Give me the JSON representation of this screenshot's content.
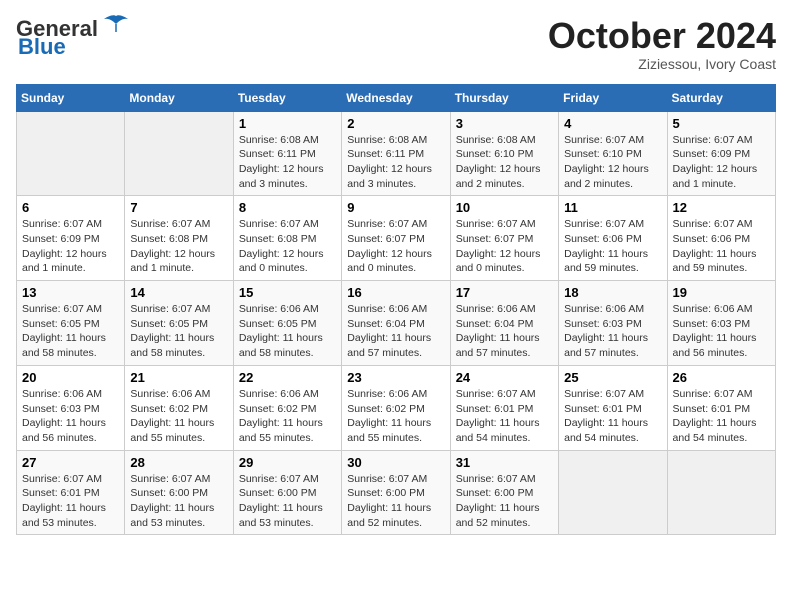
{
  "header": {
    "logo_line1": "General",
    "logo_line2": "Blue",
    "month": "October 2024",
    "location": "Ziziessou, Ivory Coast"
  },
  "weekdays": [
    "Sunday",
    "Monday",
    "Tuesday",
    "Wednesday",
    "Thursday",
    "Friday",
    "Saturday"
  ],
  "weeks": [
    [
      {
        "day": "",
        "info": ""
      },
      {
        "day": "",
        "info": ""
      },
      {
        "day": "1",
        "info": "Sunrise: 6:08 AM\nSunset: 6:11 PM\nDaylight: 12 hours and 3 minutes."
      },
      {
        "day": "2",
        "info": "Sunrise: 6:08 AM\nSunset: 6:11 PM\nDaylight: 12 hours and 3 minutes."
      },
      {
        "day": "3",
        "info": "Sunrise: 6:08 AM\nSunset: 6:10 PM\nDaylight: 12 hours and 2 minutes."
      },
      {
        "day": "4",
        "info": "Sunrise: 6:07 AM\nSunset: 6:10 PM\nDaylight: 12 hours and 2 minutes."
      },
      {
        "day": "5",
        "info": "Sunrise: 6:07 AM\nSunset: 6:09 PM\nDaylight: 12 hours and 1 minute."
      }
    ],
    [
      {
        "day": "6",
        "info": "Sunrise: 6:07 AM\nSunset: 6:09 PM\nDaylight: 12 hours and 1 minute."
      },
      {
        "day": "7",
        "info": "Sunrise: 6:07 AM\nSunset: 6:08 PM\nDaylight: 12 hours and 1 minute."
      },
      {
        "day": "8",
        "info": "Sunrise: 6:07 AM\nSunset: 6:08 PM\nDaylight: 12 hours and 0 minutes."
      },
      {
        "day": "9",
        "info": "Sunrise: 6:07 AM\nSunset: 6:07 PM\nDaylight: 12 hours and 0 minutes."
      },
      {
        "day": "10",
        "info": "Sunrise: 6:07 AM\nSunset: 6:07 PM\nDaylight: 12 hours and 0 minutes."
      },
      {
        "day": "11",
        "info": "Sunrise: 6:07 AM\nSunset: 6:06 PM\nDaylight: 11 hours and 59 minutes."
      },
      {
        "day": "12",
        "info": "Sunrise: 6:07 AM\nSunset: 6:06 PM\nDaylight: 11 hours and 59 minutes."
      }
    ],
    [
      {
        "day": "13",
        "info": "Sunrise: 6:07 AM\nSunset: 6:05 PM\nDaylight: 11 hours and 58 minutes."
      },
      {
        "day": "14",
        "info": "Sunrise: 6:07 AM\nSunset: 6:05 PM\nDaylight: 11 hours and 58 minutes."
      },
      {
        "day": "15",
        "info": "Sunrise: 6:06 AM\nSunset: 6:05 PM\nDaylight: 11 hours and 58 minutes."
      },
      {
        "day": "16",
        "info": "Sunrise: 6:06 AM\nSunset: 6:04 PM\nDaylight: 11 hours and 57 minutes."
      },
      {
        "day": "17",
        "info": "Sunrise: 6:06 AM\nSunset: 6:04 PM\nDaylight: 11 hours and 57 minutes."
      },
      {
        "day": "18",
        "info": "Sunrise: 6:06 AM\nSunset: 6:03 PM\nDaylight: 11 hours and 57 minutes."
      },
      {
        "day": "19",
        "info": "Sunrise: 6:06 AM\nSunset: 6:03 PM\nDaylight: 11 hours and 56 minutes."
      }
    ],
    [
      {
        "day": "20",
        "info": "Sunrise: 6:06 AM\nSunset: 6:03 PM\nDaylight: 11 hours and 56 minutes."
      },
      {
        "day": "21",
        "info": "Sunrise: 6:06 AM\nSunset: 6:02 PM\nDaylight: 11 hours and 55 minutes."
      },
      {
        "day": "22",
        "info": "Sunrise: 6:06 AM\nSunset: 6:02 PM\nDaylight: 11 hours and 55 minutes."
      },
      {
        "day": "23",
        "info": "Sunrise: 6:06 AM\nSunset: 6:02 PM\nDaylight: 11 hours and 55 minutes."
      },
      {
        "day": "24",
        "info": "Sunrise: 6:07 AM\nSunset: 6:01 PM\nDaylight: 11 hours and 54 minutes."
      },
      {
        "day": "25",
        "info": "Sunrise: 6:07 AM\nSunset: 6:01 PM\nDaylight: 11 hours and 54 minutes."
      },
      {
        "day": "26",
        "info": "Sunrise: 6:07 AM\nSunset: 6:01 PM\nDaylight: 11 hours and 54 minutes."
      }
    ],
    [
      {
        "day": "27",
        "info": "Sunrise: 6:07 AM\nSunset: 6:01 PM\nDaylight: 11 hours and 53 minutes."
      },
      {
        "day": "28",
        "info": "Sunrise: 6:07 AM\nSunset: 6:00 PM\nDaylight: 11 hours and 53 minutes."
      },
      {
        "day": "29",
        "info": "Sunrise: 6:07 AM\nSunset: 6:00 PM\nDaylight: 11 hours and 53 minutes."
      },
      {
        "day": "30",
        "info": "Sunrise: 6:07 AM\nSunset: 6:00 PM\nDaylight: 11 hours and 52 minutes."
      },
      {
        "day": "31",
        "info": "Sunrise: 6:07 AM\nSunset: 6:00 PM\nDaylight: 11 hours and 52 minutes."
      },
      {
        "day": "",
        "info": ""
      },
      {
        "day": "",
        "info": ""
      }
    ]
  ]
}
